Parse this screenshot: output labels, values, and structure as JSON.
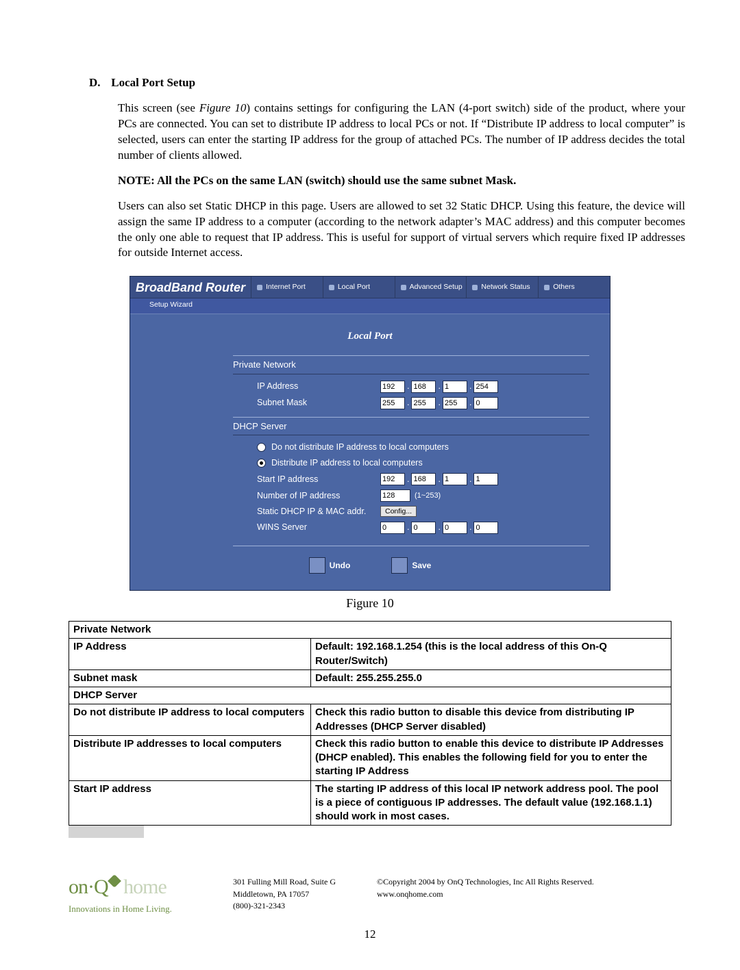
{
  "section": {
    "letter": "D.",
    "title": "Local Port Setup",
    "para1_a": "This screen (see ",
    "para1_fig": "Figure 10",
    "para1_b": ") contains settings for configuring the LAN (4-port switch) side of the product, where your PCs are connected. You can set to distribute IP address to local PCs or not. If “Distribute IP address to local computer” is selected, users can enter the starting IP address for the group of attached PCs. The number of IP address decides the total number of clients allowed.",
    "note": "NOTE: All the PCs on the same LAN (switch) should use the same subnet Mask.",
    "para2": "Users can also set Static DHCP in this page. Users are allowed to set 32 Static DHCP. Using this feature, the device will assign the same IP address to a computer (according to the network adapter’s MAC address) and this computer becomes the only one able to request that IP address. This is useful for support of virtual servers which require fixed IP addresses for outside Internet access."
  },
  "router": {
    "brand": "BroadBand Router",
    "tabs": [
      "Internet Port",
      "Local Port",
      "Advanced Setup",
      "Network Status",
      "Others"
    ],
    "wizard": "Setup Wizard",
    "title": "Local Port",
    "group1": "Private Network",
    "ip_label": "IP Address",
    "ip": [
      "192",
      "168",
      "1",
      "254"
    ],
    "mask_label": "Subnet Mask",
    "mask": [
      "255",
      "255",
      "255",
      "0"
    ],
    "group2": "DHCP Server",
    "radio_off": "Do not distribute IP address to local computers",
    "radio_on": "Distribute IP address to local computers",
    "start_label": "Start IP address",
    "start_ip": [
      "192",
      "168",
      "1",
      "1"
    ],
    "num_label": "Number of IP address",
    "num_value": "128",
    "num_hint": "(1~253)",
    "static_label": "Static DHCP IP & MAC addr.",
    "config_btn": "Config...",
    "wins_label": "WINS Server",
    "wins": [
      "0",
      "0",
      "0",
      "0"
    ],
    "undo": "Undo",
    "save": "Save"
  },
  "figure_caption": "Figure 10",
  "table": {
    "rows": [
      {
        "span": true,
        "a": "Private Network"
      },
      {
        "a": "IP Address",
        "b": "Default: 192.168.1.254 (this is the local address of this On-Q Router/Switch)"
      },
      {
        "a": "Subnet mask",
        "b": "Default:  255.255.255.0"
      },
      {
        "span": true,
        "a": "DHCP Server"
      },
      {
        "a": "Do not distribute IP address to local computers",
        "b": "Check this radio button to disable this device from distributing IP Addresses (DHCP Server disabled)"
      },
      {
        "a": "Distribute IP addresses to local computers",
        "b": "Check this radio button to enable this device to distribute IP Addresses (DHCP enabled). This enables the following field for you to enter the starting IP Address"
      },
      {
        "a": "Start IP address",
        "b": "The starting IP address of this local IP network address pool. The pool is a piece of contiguous IP addresses. The default value (192.168.1.1) should work in most cases."
      }
    ]
  },
  "footer": {
    "logo_a": "on·Q",
    "logo_b": "home",
    "tagline": "Innovations in Home Living.",
    "addr1": "301 Fulling Mill Road, Suite G",
    "addr2": "Middletown, PA   17057",
    "addr3": "(800)-321-2343",
    "copy1": "©Copyright 2004 by OnQ Technologies, Inc All Rights Reserved.",
    "copy2": "www.onqhome.com"
  },
  "page_number": "12"
}
